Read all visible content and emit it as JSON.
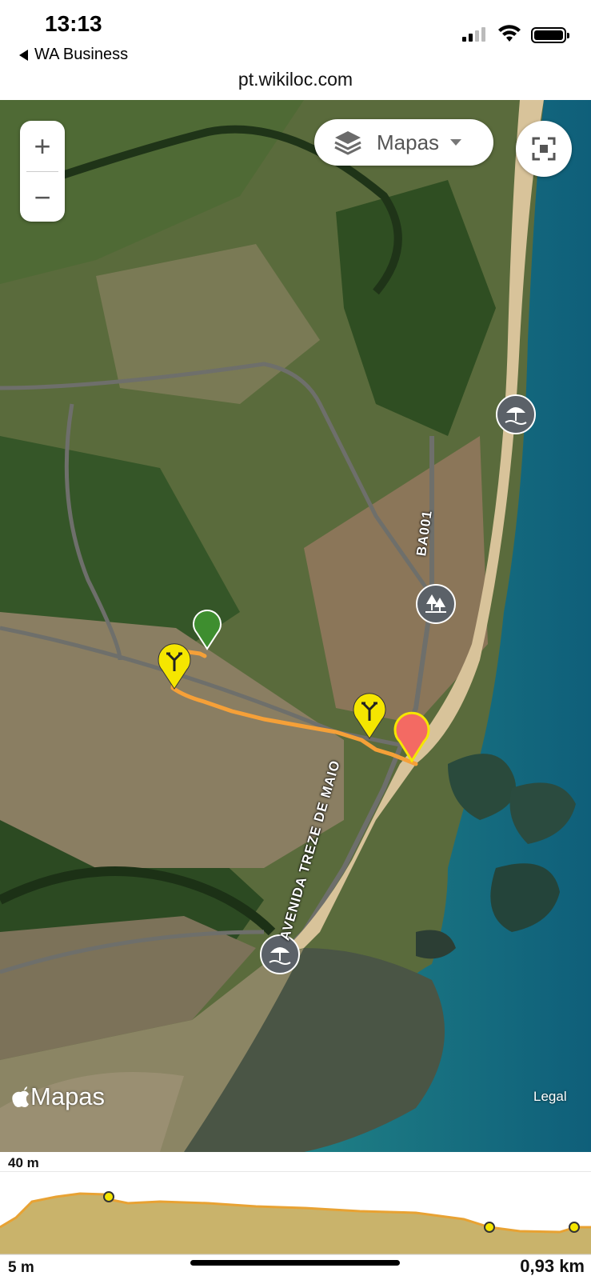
{
  "status_bar": {
    "time": "13:13",
    "back_app": "WA Business",
    "url": "pt.wikiloc.com"
  },
  "map": {
    "zoom_in_label": "+",
    "zoom_out_label": "−",
    "map_type_label": "Mapas",
    "attribution": "Mapas",
    "legal": "Legal",
    "road_labels": [
      "BA001",
      "AVENIDA TREZE DE MAIO"
    ],
    "poi_icons": [
      "beach-icon",
      "park-icon",
      "beach-icon"
    ],
    "colors": {
      "track": "#f5a038",
      "start_pin": "#3e8e2f",
      "end_pin": "#f36a63",
      "waypoint": "#f5e600"
    }
  },
  "elevation": {
    "max_label": "40 m",
    "min_label": "5 m",
    "distance_label": "0,93 km",
    "profile_color": "#e8a233",
    "fill_color": "#c9b36b"
  }
}
